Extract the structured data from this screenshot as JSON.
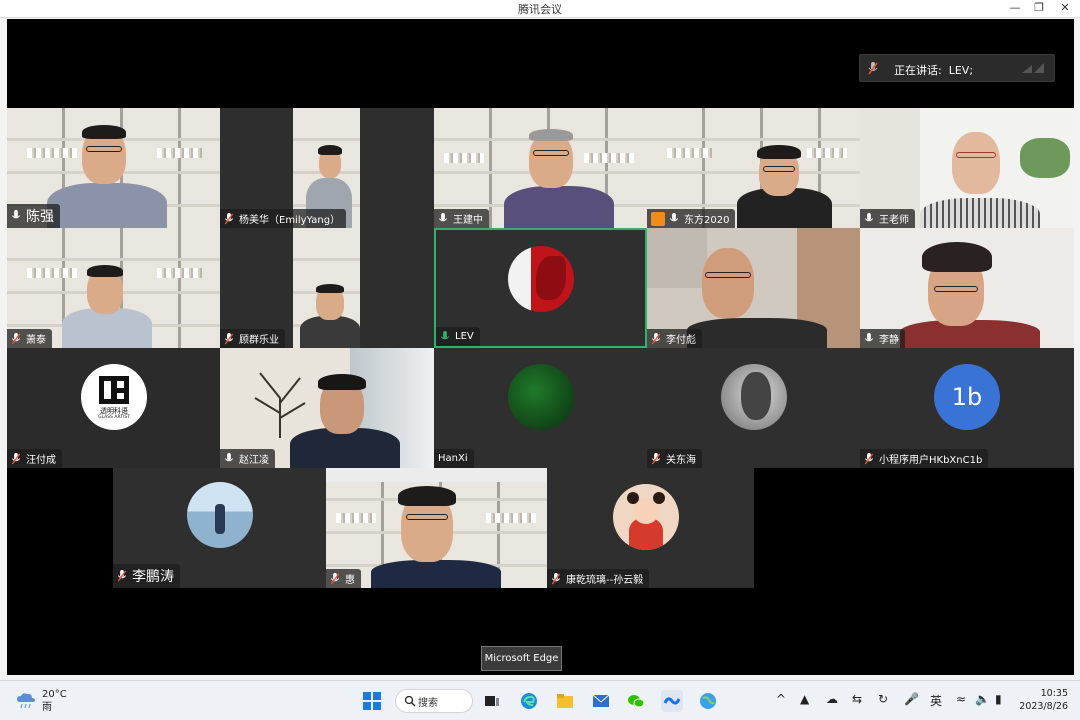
{
  "window": {
    "title": "腾讯会议"
  },
  "speaking": {
    "label": "正在讲话:",
    "name": "LEV;"
  },
  "participants": [
    {
      "name": "陈强"
    },
    {
      "name": "杨美华（EmilyYang）"
    },
    {
      "name": "王建中"
    },
    {
      "name": "东方2020"
    },
    {
      "name": "王老师"
    },
    {
      "name": "萧泰"
    },
    {
      "name": "顾群乐业"
    },
    {
      "name": "LEV"
    },
    {
      "name": "李付彪"
    },
    {
      "name": "李静"
    },
    {
      "name": "汪付成"
    },
    {
      "name": "赵江凌"
    },
    {
      "name": "HanXi"
    },
    {
      "name": "关东海"
    },
    {
      "name": "小程序用户HKbXnC1b"
    },
    {
      "name": "李鹏涛"
    },
    {
      "name": "惠"
    },
    {
      "name": "康乾琉璃--孙云毅"
    }
  ],
  "logo_tile": {
    "brand": "透明科语",
    "sub": "GLASS ARTIST"
  },
  "initials_avatar": {
    "text": "1b",
    "color": "#3a73d6"
  },
  "tooltip": {
    "text": "Microsoft Edge"
  },
  "taskbar": {
    "weather_temp": "20°C",
    "weather_cond": "雨",
    "search_label": "搜索",
    "ime_label": "英",
    "time": "10:35",
    "date": "2023/8/26"
  },
  "colors": {
    "active_speaker_border": "#2fb36b",
    "muted_mic": "#e0543c",
    "active_mic": "#2fb36b"
  }
}
